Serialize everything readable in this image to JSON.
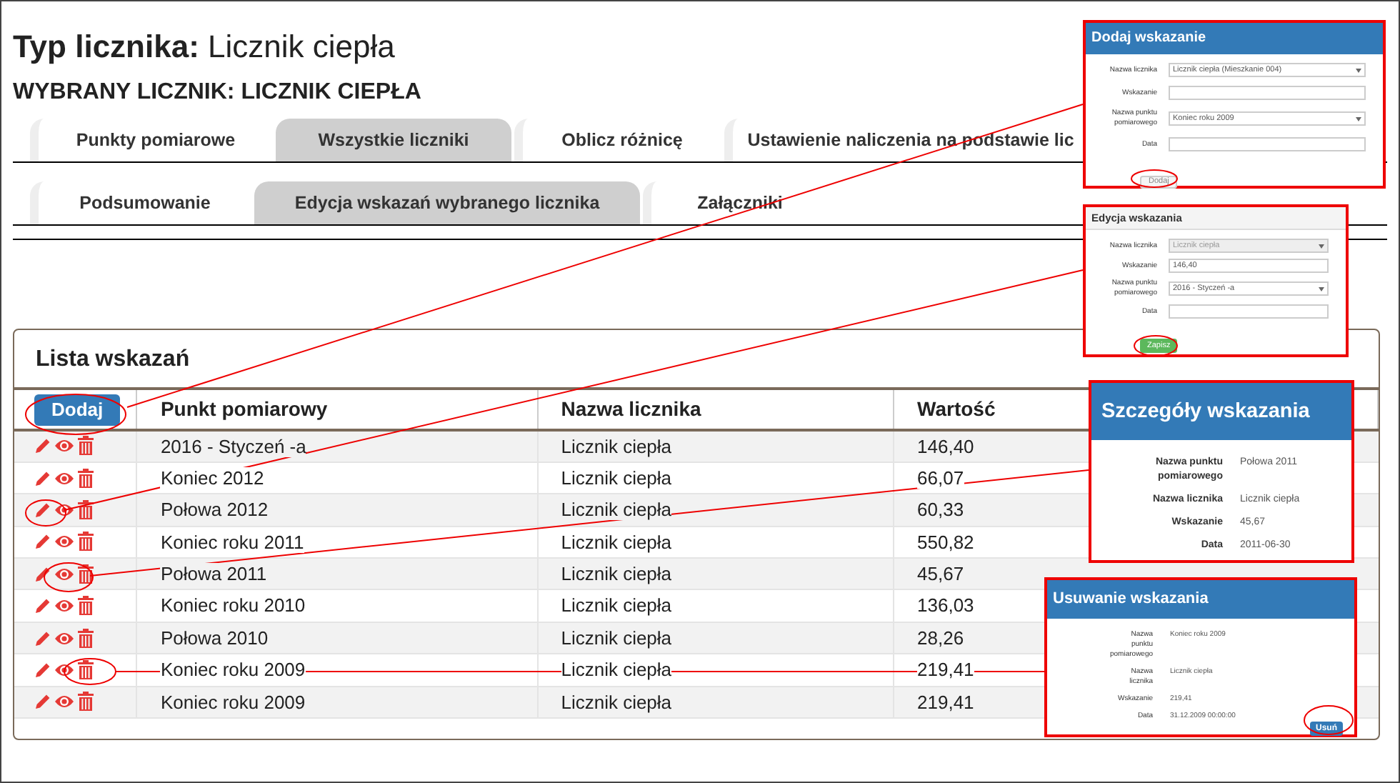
{
  "page_title": {
    "label": "Typ licznika:",
    "value": "Licznik ciepła"
  },
  "selected_meter": "WYBRANY LICZNIK: LICZNIK CIEPŁA",
  "tabs_row_1": [
    {
      "label": "Punkty pomiarowe",
      "selected": false
    },
    {
      "label": "Wszystkie liczniki",
      "selected": true
    },
    {
      "label": "Oblicz różnicę",
      "selected": false
    },
    {
      "label": "Ustawienie naliczenia na podstawie lic",
      "selected": false
    }
  ],
  "tabs_row_2": [
    {
      "label": "Podsumowanie",
      "selected": false
    },
    {
      "label": "Edycja wskazań wybranego licznika",
      "selected": true
    },
    {
      "label": "Załączniki",
      "selected": false
    }
  ],
  "panel": {
    "title": "Lista wskazań",
    "add_button": "Dodaj",
    "columns": [
      "Punkt pomiarowy",
      "Nazwa licznika",
      "Wartość"
    ],
    "rows": [
      {
        "point": "2016 - Styczeń -a",
        "meter": "Licznik ciepła",
        "value": "146,40"
      },
      {
        "point": "Koniec 2012",
        "meter": "Licznik ciepła",
        "value": "66,07"
      },
      {
        "point": "Połowa 2012",
        "meter": "Licznik ciepła",
        "value": "60,33"
      },
      {
        "point": "Koniec roku 2011",
        "meter": "Licznik ciepła",
        "value": "550,82"
      },
      {
        "point": "Połowa 2011",
        "meter": "Licznik ciepła",
        "value": "45,67"
      },
      {
        "point": "Koniec roku 2010",
        "meter": "Licznik ciepła",
        "value": "136,03"
      },
      {
        "point": "Połowa 2010",
        "meter": "Licznik ciepła",
        "value": "28,26"
      },
      {
        "point": "Koniec roku 2009",
        "meter": "Licznik ciepła",
        "value": "219,41"
      },
      {
        "point": "Koniec roku 2009",
        "meter": "Licznik ciepła",
        "value": "219,41"
      }
    ]
  },
  "add_dialog": {
    "title": "Dodaj wskazanie",
    "fields": [
      {
        "label": "Nazwa licznika",
        "kind": "select",
        "value": "Licznik ciepła (Mieszkanie 004)",
        "disabled": false
      },
      {
        "label": "Wskazanie",
        "kind": "input",
        "disabled": false
      },
      {
        "label": "Nazwa punktu pomiarowego",
        "kind": "select",
        "value": "Koniec roku 2009",
        "disabled": false
      },
      {
        "label": "Data",
        "kind": "input",
        "disabled": false
      }
    ],
    "button": "Dodaj"
  },
  "edit_dialog": {
    "title": "Edycja wskazania",
    "fields": [
      {
        "label": "Nazwa licznika",
        "kind": "select",
        "value": "Licznik ciepła",
        "disabled": true
      },
      {
        "label": "Wskazanie",
        "kind": "input",
        "value": "146,40",
        "disabled": false
      },
      {
        "label": "Nazwa punktu pomiarowego",
        "kind": "select",
        "value": "2016 - Styczeń -a",
        "disabled": false
      },
      {
        "label": "Data",
        "kind": "input",
        "disabled": false
      }
    ],
    "button": "Zapisz"
  },
  "details_dialog": {
    "title": "Szczegóły wskazania",
    "rows": [
      {
        "label": "Nazwa punktu pomiarowego",
        "value": "Połowa 2011"
      },
      {
        "label": "Nazwa licznika",
        "value": "Licznik ciepła"
      },
      {
        "label": "Wskazanie",
        "value": "45,67"
      },
      {
        "label": "Data",
        "value": "2011-06-30"
      }
    ]
  },
  "delete_dialog": {
    "title": "Usuwanie wskazania",
    "rows": [
      {
        "label": "Nazwa punktu pomiarowego",
        "value": "Koniec roku 2009"
      },
      {
        "label": "Nazwa licznika",
        "value": "Licznik ciepła"
      },
      {
        "label": "Wskazanie",
        "value": "219,41"
      },
      {
        "label": "Data",
        "value": "31.12.2009 00:00:00"
      }
    ],
    "button": "Usuń"
  }
}
